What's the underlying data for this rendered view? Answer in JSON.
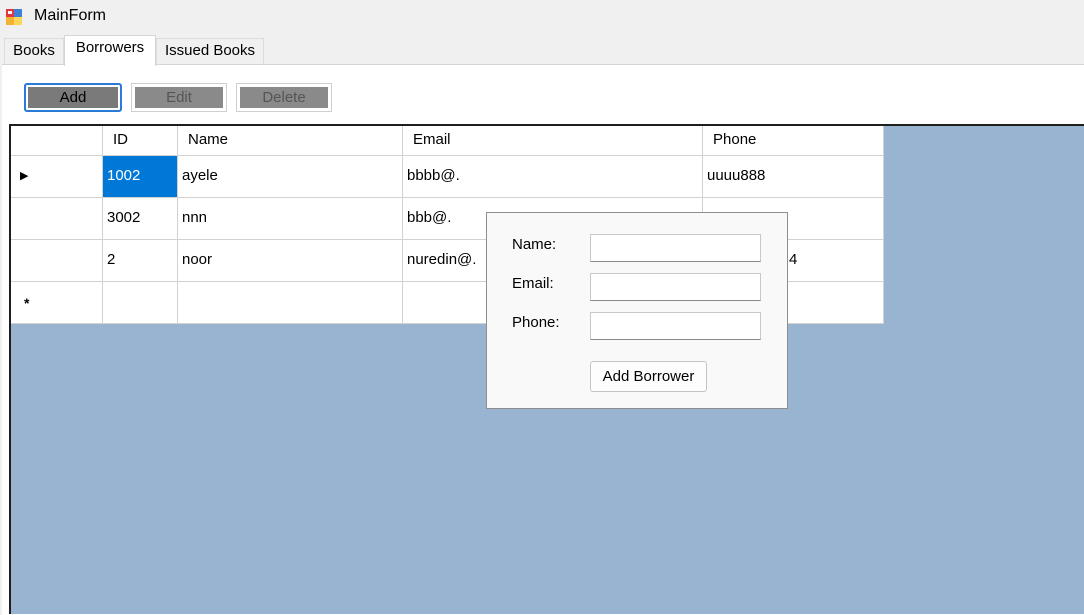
{
  "window": {
    "title": "MainForm",
    "icon": "app-form-icon"
  },
  "tabs": [
    {
      "label": "Books",
      "active": false
    },
    {
      "label": "Borrowers",
      "active": true
    },
    {
      "label": "Issued Books",
      "active": false
    }
  ],
  "toolbar": {
    "add_label": "Add",
    "edit_label": "Edit",
    "delete_label": "Delete"
  },
  "grid": {
    "columns": [
      "ID",
      "Name",
      "Email",
      "Phone"
    ],
    "rows": [
      {
        "id": "1002",
        "name": "ayele",
        "email": "bbbb@.",
        "phone": "uuuu888",
        "current": true
      },
      {
        "id": "3002",
        "name": "nnn",
        "email": "bbb@.",
        "phone": ""
      },
      {
        "id": "2",
        "name": "noor",
        "email": "nuredin@.",
        "phone": "4"
      }
    ],
    "new_row_marker": "*",
    "current_row_marker": "▶",
    "background_color": "#99b4d1",
    "selection_color": "#0078d7"
  },
  "add_borrower_form": {
    "name_label": "Name:",
    "email_label": "Email:",
    "phone_label": "Phone:",
    "name_value": "",
    "email_value": "",
    "phone_value": "",
    "submit_label": "Add Borrower"
  }
}
